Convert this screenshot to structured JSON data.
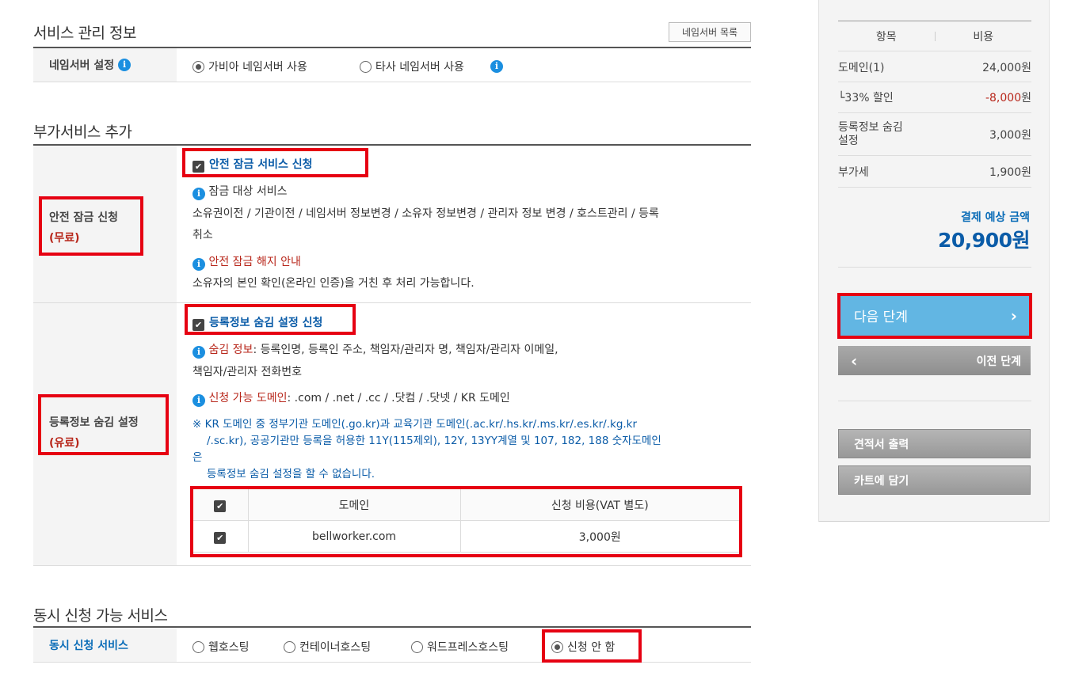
{
  "service_mgmt": {
    "title": "서비스 관리 정보",
    "ns_list_button": "네임서버 목록",
    "ns_label": "네임서버 설정",
    "ns_options": [
      "가비아 네임서버 사용",
      "타사 네임서버 사용"
    ],
    "ns_selected": "가비아 네임서버 사용"
  },
  "addon": {
    "title": "부가서비스 추가",
    "lock": {
      "label": "안전 잠금 신청",
      "label_sub": "(무료)",
      "checkbox_label": "안전 잠금 서비스 신청",
      "target_title": "잠금 대상 서비스",
      "target_line1": "소유권이전 / 기관이전 / 네임서버 정보변경 / 소유자 정보변경 / 관리자 정보 변경 / 호스트관리 / 등록",
      "target_line2": "취소",
      "release_title": "안전 잠금 해지 안내",
      "release_text": "소유자의 본인 확인(온라인 인증)을 거친 후 처리 가능합니다."
    },
    "privacy": {
      "label": "등록정보 숨김 설정",
      "label_sub": "(유료)",
      "checkbox_label": "등록정보 숨김 설정 신청",
      "hide_title": "숨김 정보",
      "hide_text1": ": 등록인명, 등록인 주소, 책임자/관리자 명, 책임자/관리자 이메일,",
      "hide_text2": "책임자/관리자 전화번호",
      "avail_title": "신청 가능 도메인",
      "avail_text": ": .com / .net / .cc / .닷컴 / .닷넷 / KR 도메인",
      "note1": "※ KR 도메인 중 정부기관 도메인(.go.kr)과 교육기관 도메인(.ac.kr/.hs.kr/.ms.kr/.es.kr/.kg.kr",
      "note2": "/.sc.kr), 공공기관만 등록을 허용한 11Y(115제외), 12Y, 13YY계열 및 107, 182, 188 숫자도메인",
      "note3": "은",
      "note4": "등록정보 숨김 설정을 할 수 없습니다.",
      "table": {
        "headers": [
          "도메인",
          "신청 비용(VAT 별도)"
        ],
        "rows": [
          {
            "domain": "bellworker.com",
            "cost": "3,000원"
          }
        ]
      }
    }
  },
  "concurrent": {
    "title": "동시 신청 가능 서비스",
    "label": "동시 신청 서비스",
    "options": [
      "웹호스팅",
      "컨테이너호스팅",
      "워드프레스호스팅",
      "신청 안 함"
    ],
    "selected": "신청 안 함"
  },
  "summary": {
    "col_item": "항목",
    "col_cost": "비용",
    "rows": [
      {
        "item": "도메인(1)",
        "cost": "24,000원"
      },
      {
        "item": "└33% 할인",
        "cost": "-8,000",
        "cost_unit": "원"
      },
      {
        "item_line1": "등록정보 숨김",
        "item_line2": "설정",
        "cost": "3,000원"
      },
      {
        "item": "부가세",
        "cost": "1,900원"
      }
    ],
    "total_label": "결제 예상 금액",
    "total_value": "20,900원",
    "next_button": "다음 단계",
    "prev_button": "이전 단계",
    "estimate_button": "견적서 출력",
    "cart_button": "카트에 담기"
  },
  "colors": {
    "accent_blue": "#0b5ca8",
    "next_button": "#62b6e3",
    "highlight_red": "#e60012",
    "discount_red": "#b8271b"
  }
}
